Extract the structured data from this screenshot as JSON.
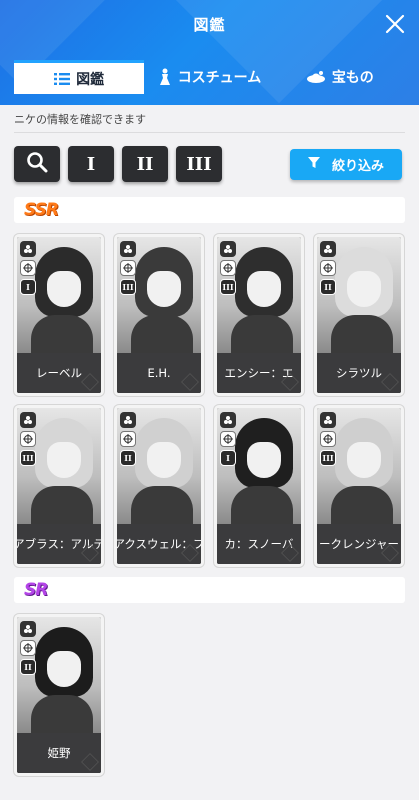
{
  "header": {
    "title": "図鑑"
  },
  "tabs": [
    {
      "label": "図鑑",
      "icon": "list-icon",
      "active": true
    },
    {
      "label": "コスチューム",
      "icon": "costume-icon",
      "active": false
    },
    {
      "label": "宝もの",
      "icon": "treasure-icon",
      "active": false
    }
  ],
  "description": "ニケの情報を確認できます",
  "filters": {
    "search_icon": "search-icon",
    "burst_buttons": [
      "I",
      "II",
      "III"
    ],
    "sort_label": "絞り込み"
  },
  "sections": [
    {
      "rarity": "SSR",
      "color": "#ff7a18",
      "cards": [
        {
          "name": "レーベル",
          "burst": "I",
          "hair": "#2b2b2b"
        },
        {
          "name": "E.H.",
          "burst": "III",
          "hair": "#3a3a3a"
        },
        {
          "name": "エンシー：エ",
          "burst": "III",
          "hair": "#2e2e2e"
        },
        {
          "name": "シラツル",
          "burst": "II",
          "hair": "#dcdcdc"
        },
        {
          "name": "アブラス：アルテ",
          "burst": "III",
          "hair": "#d6d6d6"
        },
        {
          "name": "アクスウェル：フ",
          "burst": "II",
          "hair": "#d0d0d0"
        },
        {
          "name": "カ：スノーバ",
          "burst": "I",
          "hair": "#1f1f1f"
        },
        {
          "name": "ークレンジャー",
          "burst": "III",
          "hair": "#cfcfcf"
        }
      ]
    },
    {
      "rarity": "SR",
      "color": "#b444e8",
      "cards": [
        {
          "name": "姫野",
          "burst": "II",
          "hair": "#1c1c1c"
        }
      ]
    }
  ]
}
